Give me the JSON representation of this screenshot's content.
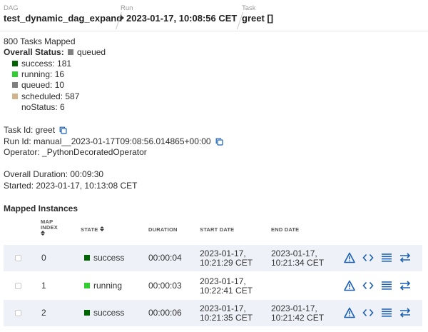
{
  "breadcrumb": {
    "dag_label": "DAG",
    "dag_value": "test_dynamic_dag_expand",
    "run_label": "Run",
    "run_value": "2023-01-17, 10:08:56 CET",
    "task_label": "Task",
    "task_value": "greet []"
  },
  "summary": {
    "mapped_count": "800 Tasks Mapped",
    "overall_status_label": "Overall Status:",
    "overall_status_value": "queued",
    "statuses": [
      {
        "label": "success: 181",
        "color": "#006400"
      },
      {
        "label": "running: 16",
        "color": "#32cd32"
      },
      {
        "label": "queued: 10",
        "color": "#808080"
      },
      {
        "label": "scheduled: 587",
        "color": "#d2b48c"
      },
      {
        "label": "noStatus: 6",
        "color": ""
      }
    ]
  },
  "details": {
    "task_id": "Task Id: greet",
    "run_id": "Run Id: manual__2023-01-17T09:08:56.014865+00:00",
    "operator": "Operator: _PythonDecoratedOperator",
    "overall_duration": "Overall Duration: 00:09:30",
    "started": "Started: 2023-01-17, 10:13:08 CET"
  },
  "mapped_instances": {
    "title": "Mapped Instances",
    "headers": {
      "map_index_line1": "MAP",
      "map_index_line2": "INDEX",
      "state": "STATE",
      "duration": "DURATION",
      "start_date": "START DATE",
      "end_date": "END DATE"
    },
    "rows": [
      {
        "index": "0",
        "state": "success",
        "state_color": "#006400",
        "duration": "00:00:04",
        "start_1": "2023-01-17,",
        "start_2": "10:21:29 CET",
        "end_1": "2023-01-17,",
        "end_2": "10:21:34 CET"
      },
      {
        "index": "1",
        "state": "running",
        "state_color": "#32cd32",
        "duration": "00:00:03",
        "start_1": "2023-01-17,",
        "start_2": "10:22:41 CET",
        "end_1": "",
        "end_2": ""
      },
      {
        "index": "2",
        "state": "success",
        "state_color": "#006400",
        "duration": "00:00:06",
        "start_1": "2023-01-17,",
        "start_2": "10:21:35 CET",
        "end_1": "2023-01-17,",
        "end_2": "10:21:42 CET"
      }
    ]
  },
  "colors": {
    "accent": "#1a5fb4",
    "sort_arrow": "#333333"
  },
  "icons": {
    "row_actions": [
      "warning-triangle-icon",
      "code-icon",
      "log-lines-icon",
      "swap-arrows-icon"
    ],
    "copy": "copy-icon",
    "play": "play-icon"
  }
}
